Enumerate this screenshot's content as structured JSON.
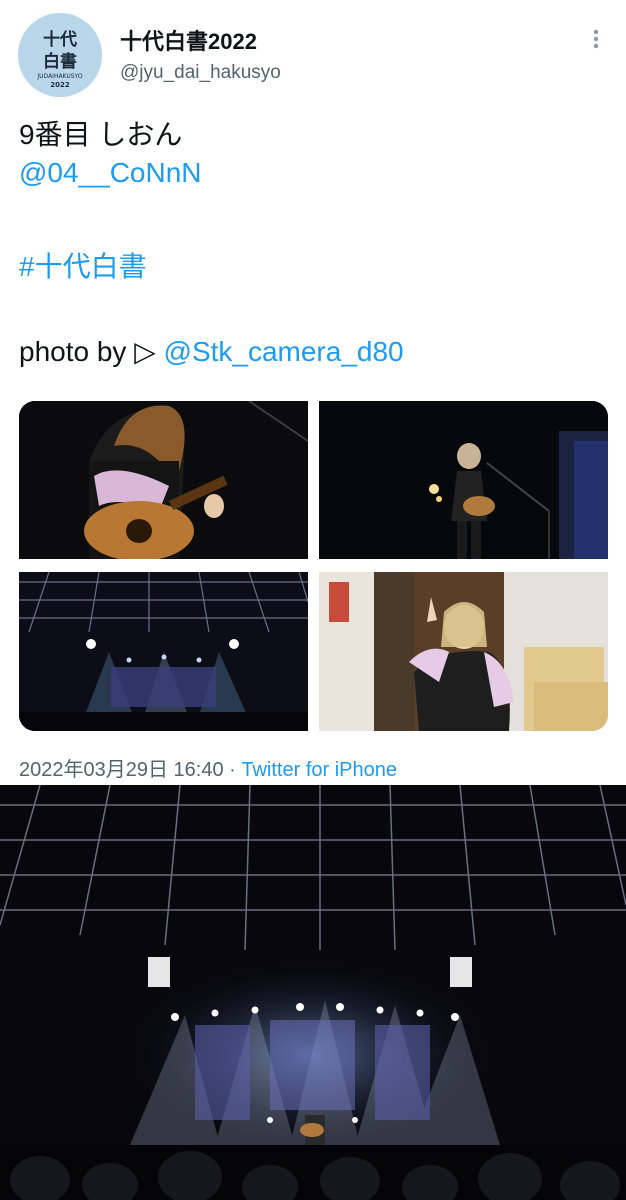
{
  "profile": {
    "avatar_text_top": "十代",
    "avatar_text_bottom": "白書",
    "avatar_caption": "JUDAIHAKUSYO",
    "avatar_year": "2022",
    "display_name": "十代白書2022",
    "handle": "@jyu_dai_hakusyo"
  },
  "tweet": {
    "line1": "9番目 しおん",
    "mention1": "@04__CoNnN",
    "hashtag": "#十代白書",
    "photo_prefix": "photo by ▷ ",
    "photo_mention": "@Stk_camera_d80"
  },
  "photos": [
    {
      "icon": "guitarist-closeup-photo"
    },
    {
      "icon": "performer-on-stage-photo"
    },
    {
      "icon": "concert-stage-wide-photo"
    },
    {
      "icon": "backstage-peace-sign-photo"
    }
  ],
  "meta": {
    "timestamp": "2022年03月29日 16:40",
    "separator": " · ",
    "source": "Twitter for iPhone"
  },
  "colors": {
    "text": "#0f1419",
    "secondary": "#536471",
    "link": "#1d9bf0",
    "avatar_bg": "#b9d6ea"
  }
}
